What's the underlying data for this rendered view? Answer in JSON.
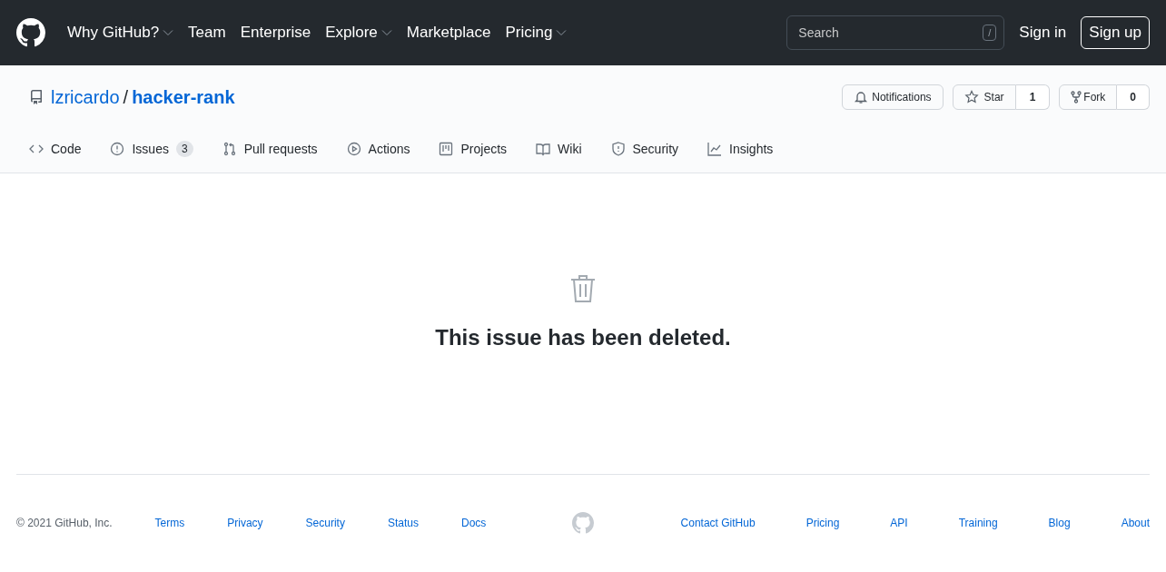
{
  "header": {
    "nav": [
      {
        "label": "Why GitHub?",
        "dropdown": true
      },
      {
        "label": "Team",
        "dropdown": false
      },
      {
        "label": "Enterprise",
        "dropdown": false
      },
      {
        "label": "Explore",
        "dropdown": true
      },
      {
        "label": "Marketplace",
        "dropdown": false
      },
      {
        "label": "Pricing",
        "dropdown": true
      }
    ],
    "search": {
      "placeholder": "Search",
      "shortcut": "/"
    },
    "sign_in": "Sign in",
    "sign_up": "Sign up"
  },
  "repo": {
    "owner": "lzricardo",
    "separator": "/",
    "name": "hacker-rank",
    "notifications": "Notifications",
    "star": {
      "label": "Star",
      "count": "1"
    },
    "fork": {
      "label": "Fork",
      "count": "0"
    }
  },
  "tabs": [
    {
      "label": "Code",
      "selected": false
    },
    {
      "label": "Issues",
      "counter": "3",
      "selected": false
    },
    {
      "label": "Pull requests",
      "selected": false
    },
    {
      "label": "Actions",
      "selected": false
    },
    {
      "label": "Projects",
      "selected": false
    },
    {
      "label": "Wiki",
      "selected": false
    },
    {
      "label": "Security",
      "selected": false
    },
    {
      "label": "Insights",
      "selected": false
    }
  ],
  "message": "This issue has been deleted.",
  "footer": {
    "copyright": "© 2021 GitHub, Inc.",
    "left_links": [
      "Terms",
      "Privacy",
      "Security",
      "Status",
      "Docs"
    ],
    "right_links": [
      "Contact GitHub",
      "Pricing",
      "API",
      "Training",
      "Blog",
      "About"
    ]
  }
}
